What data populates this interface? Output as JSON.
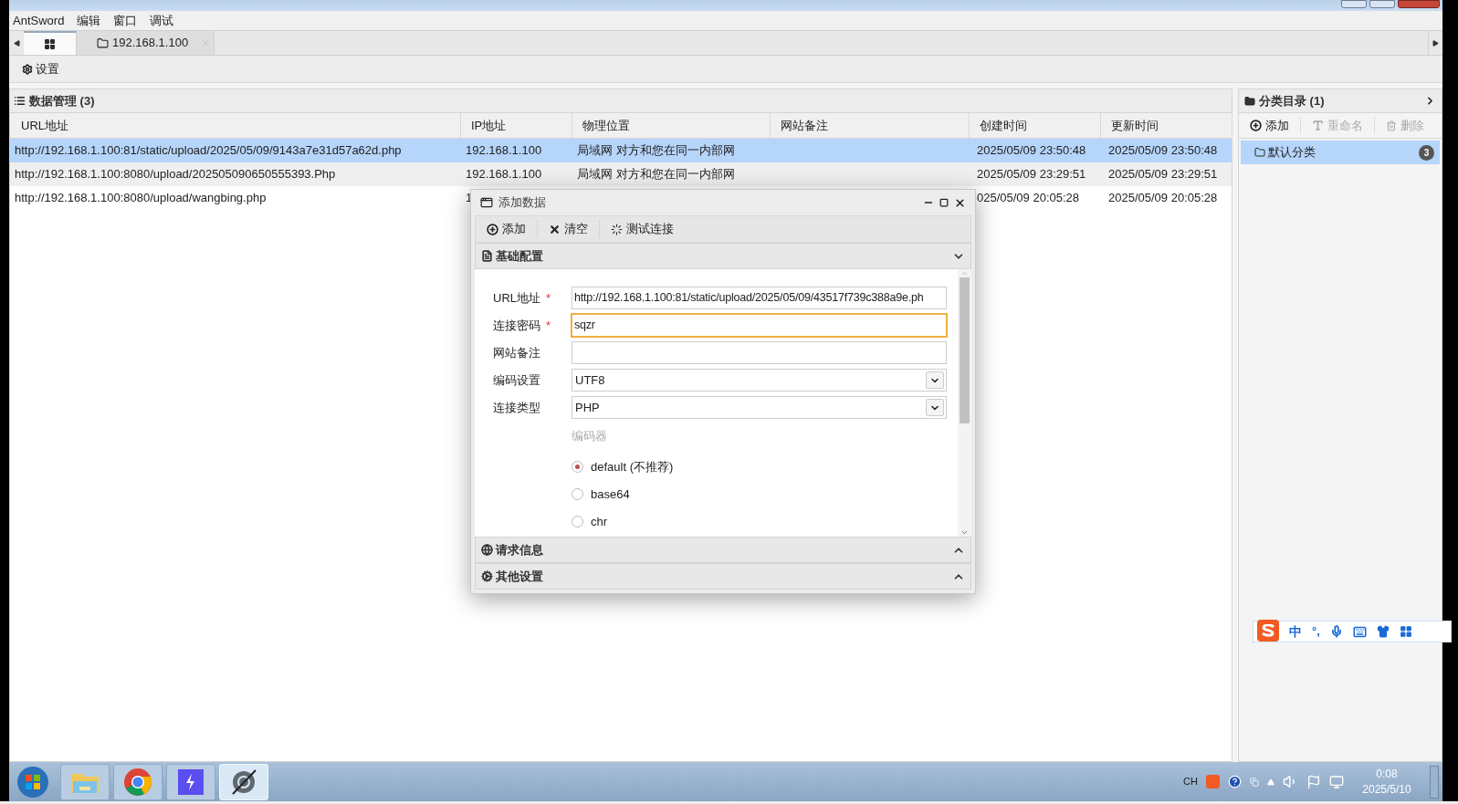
{
  "menu": [
    "AntSword",
    "编辑",
    "窗口",
    "调试"
  ],
  "tabs": [
    {
      "kind": "home",
      "selected": true
    },
    {
      "kind": "host",
      "label": "192.168.1.100",
      "selected": false
    }
  ],
  "toolbar": {
    "settings": "设置"
  },
  "data_panel": {
    "title": "数据管理 (3)",
    "columns": [
      "URL地址",
      "IP地址",
      "物理位置",
      "网站备注",
      "创建时间",
      "更新时间"
    ],
    "rows": [
      {
        "selected": true,
        "url": "http://192.168.1.100:81/static/upload/2025/05/09/9143a7e31d57a62d.php",
        "ip": "192.168.1.100",
        "location": "局域网 对方和您在同一内部网",
        "created": "2025/05/09 23:50:48",
        "updated": "2025/05/09 23:50:48"
      },
      {
        "selected": false,
        "url": "http://192.168.1.100:8080/upload/202505090650555393.Php",
        "ip": "192.168.1.100",
        "location": "局域网 对方和您在同一内部网",
        "created": "2025/05/09 23:29:51",
        "updated": "2025/05/09 23:29:51"
      },
      {
        "selected": false,
        "url": "http://192.168.1.100:8080/upload/wangbing.php",
        "ip": "1",
        "created": "025/05/09 20:05:28",
        "updated": "2025/05/09 20:05:28"
      }
    ]
  },
  "category_panel": {
    "title": "分类目录 (1)",
    "actions": [
      {
        "kind": "add",
        "label": "添加",
        "disabled": false
      },
      {
        "kind": "rename",
        "label": "重命名",
        "disabled": true
      },
      {
        "kind": "delete",
        "label": "删除",
        "disabled": true
      }
    ],
    "items": [
      {
        "label": "默认分类",
        "count": "3",
        "selected": true
      }
    ]
  },
  "dialog": {
    "title": "添加数据",
    "actions": [
      {
        "kind": "add",
        "label": "添加"
      },
      {
        "kind": "clear",
        "label": "清空"
      },
      {
        "kind": "test",
        "label": "测试连接"
      }
    ],
    "sections": [
      {
        "kind": "basic",
        "title": "基础配置",
        "expanded": true
      },
      {
        "kind": "request",
        "title": "请求信息",
        "expanded": false
      },
      {
        "kind": "other",
        "title": "其他设置",
        "expanded": false
      }
    ],
    "fields": [
      {
        "kind": "text",
        "label": "URL地址",
        "mark": "*",
        "focused": false,
        "value": "http://192.168.1.100:81/static/upload/2025/05/09/43517f739c388a9e.ph"
      },
      {
        "kind": "text",
        "label": "连接密码",
        "mark": "*",
        "focused": true,
        "value": "sqzr"
      },
      {
        "kind": "text",
        "label": "网站备注",
        "focused": false
      },
      {
        "kind": "select",
        "label": "编码设置",
        "focused": false,
        "value": "UTF8"
      },
      {
        "kind": "select",
        "label": "连接类型",
        "focused": false,
        "value": "PHP"
      }
    ],
    "encoder_label": "编码器",
    "encoders": [
      {
        "label": "default (不推荐)",
        "selected": true
      },
      {
        "label": "base64",
        "selected": false
      },
      {
        "label": "chr",
        "selected": false
      }
    ]
  },
  "ime_bar": {
    "mode": "中",
    "punct": "°,"
  },
  "taskbar": {
    "apps": [
      {
        "kind": "explorer",
        "active": false
      },
      {
        "kind": "chrome",
        "active": false
      },
      {
        "kind": "bolt",
        "active": false
      },
      {
        "kind": "antsword",
        "active": true
      }
    ],
    "lang": "CH",
    "time": "0:08",
    "date": "2025/5/10"
  }
}
